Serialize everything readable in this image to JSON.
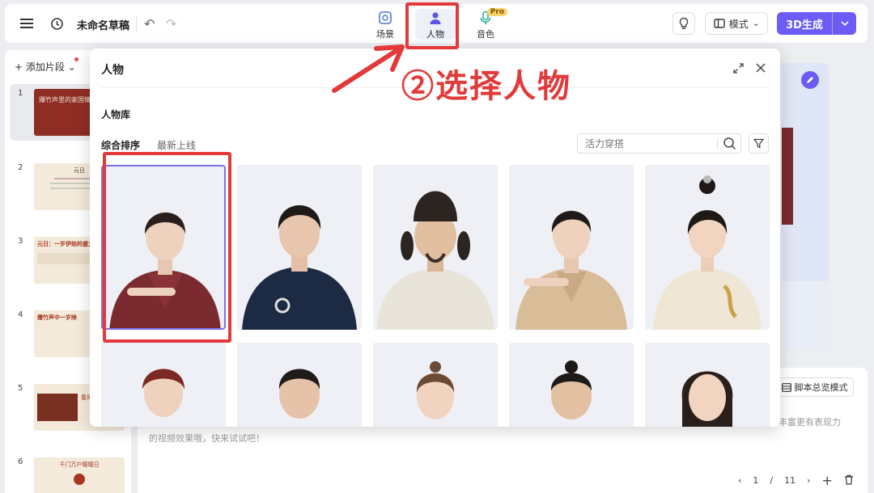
{
  "topbar": {
    "doc_title": "未命名草稿",
    "tabs": [
      {
        "label": "场景",
        "icon": "scene-icon"
      },
      {
        "label": "人物",
        "icon": "person-icon"
      },
      {
        "label": "音色",
        "icon": "microphone-icon",
        "badge": "Pro"
      }
    ],
    "mode_label": "模式",
    "generate_label": "3D生成",
    "accent_color": "#6a5cf5"
  },
  "sidebar": {
    "add_label": "添加片段",
    "slides": [
      {
        "num": "1",
        "text": "爆竹声里的家国情怀"
      },
      {
        "num": "2",
        "text": "元日"
      },
      {
        "num": "3",
        "text": "元日：一岁伊始的盛大仪式"
      },
      {
        "num": "4",
        "text": "爆竹声中一岁除"
      },
      {
        "num": "5",
        "text": "春风送暖入屠苏"
      },
      {
        "num": "6",
        "text": "千门万户曈曈日"
      }
    ]
  },
  "modal": {
    "title": "人物",
    "library_title": "人物库",
    "sort_tabs": [
      "综合排序",
      "最新上线"
    ],
    "search_placeholder": "活力穿搭",
    "characters": [
      {
        "name": "female-burgundy-suit"
      },
      {
        "name": "male-navy-sweater"
      },
      {
        "name": "male-tang-official"
      },
      {
        "name": "female-beige-suit"
      },
      {
        "name": "female-dragon-hanfu"
      },
      {
        "name": "female-red-headband"
      },
      {
        "name": "male-short-hair"
      },
      {
        "name": "female-braided"
      },
      {
        "name": "male-topknot"
      },
      {
        "name": "female-long-hair"
      }
    ]
  },
  "annotation": {
    "label": "②选择人物",
    "color": "#e23a3a"
  },
  "bottom": {
    "script_mode_label": "脚本总览模式",
    "hint_tail": "丰富更有表现力",
    "hint_line": "的视频效果哦，快来试试吧！",
    "page_current": "1",
    "page_sep": "/",
    "page_total": "11"
  }
}
